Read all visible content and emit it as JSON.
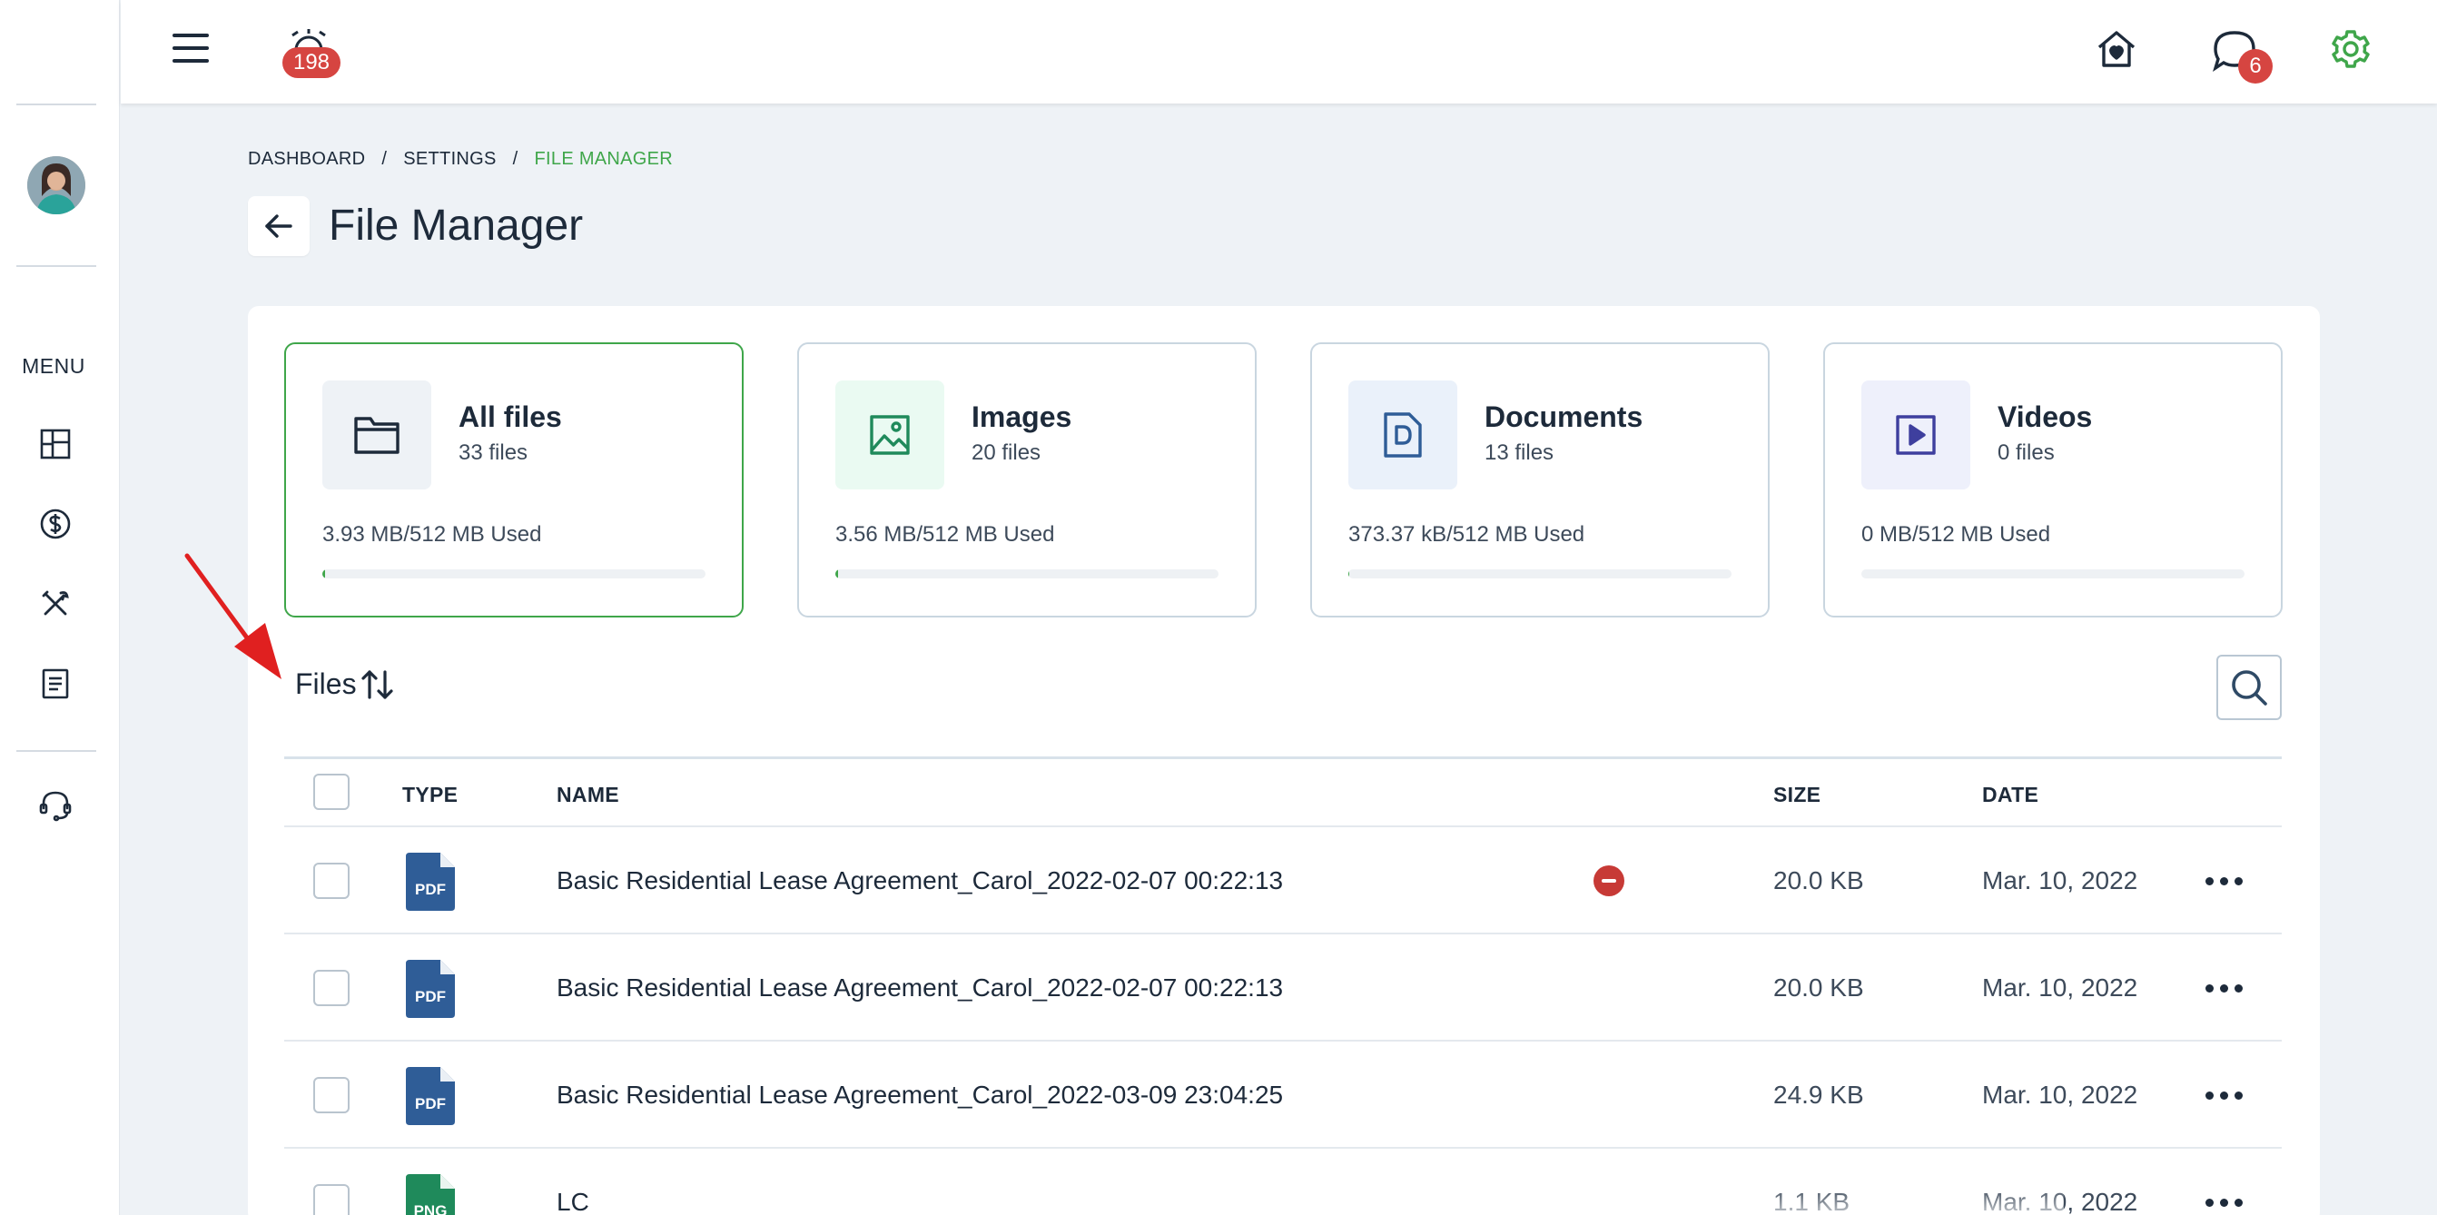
{
  "topbar": {
    "notification_count": "198",
    "messages_count": "6"
  },
  "sidebar": {
    "menu_label": "MENU",
    "items": [
      {
        "icon": "dashboard-icon"
      },
      {
        "icon": "dollar-icon"
      },
      {
        "icon": "tools-icon"
      },
      {
        "icon": "document-icon"
      },
      {
        "icon": "support-icon"
      }
    ]
  },
  "breadcrumb": {
    "items": [
      "DASHBOARD",
      "SETTINGS",
      "FILE MANAGER"
    ],
    "separator": "/"
  },
  "page": {
    "title": "File Manager"
  },
  "stats": [
    {
      "title": "All files",
      "count": "33 files",
      "used": "3.93 MB/512 MB Used",
      "fraction": 0.0077,
      "icon": "folder-icon",
      "active": true
    },
    {
      "title": "Images",
      "count": "20 files",
      "used": "3.56 MB/512 MB Used",
      "fraction": 0.007,
      "icon": "image-icon",
      "active": false
    },
    {
      "title": "Documents",
      "count": "13 files",
      "used": "373.37 kB/512 MB Used",
      "fraction": 0.0007,
      "icon": "doc-icon",
      "active": false
    },
    {
      "title": "Videos",
      "count": "0 files",
      "used": "0 MB/512 MB Used",
      "fraction": 0,
      "icon": "video-icon",
      "active": false
    }
  ],
  "files_section": {
    "heading": "Files",
    "sort_icon": "sort-icon",
    "search_icon": "search-icon"
  },
  "table": {
    "columns": [
      "TYPE",
      "NAME",
      "SIZE",
      "DATE"
    ],
    "rows": [
      {
        "type": "PDF",
        "name": "Basic Residential Lease Agreement_Carol_2022-02-07 00:22:13",
        "size": "20.0 KB",
        "date": "Mar. 10, 2022",
        "has_remove": true
      },
      {
        "type": "PDF",
        "name": "Basic Residential Lease Agreement_Carol_2022-02-07 00:22:13",
        "size": "20.0 KB",
        "date": "Mar. 10, 2022",
        "has_remove": false
      },
      {
        "type": "PDF",
        "name": "Basic Residential Lease Agreement_Carol_2022-03-09 23:04:25",
        "size": "24.9 KB",
        "date": "Mar. 10, 2022",
        "has_remove": false
      },
      {
        "type": "PNG",
        "name": "LC",
        "size": "1.1 KB",
        "date": "Mar. 10, 2022",
        "has_remove": false
      }
    ]
  },
  "colors": {
    "accent_green": "#3fa64a",
    "badge_red": "#d64541",
    "pdf_blue": "#2f5d97",
    "png_green": "#1f8a5b"
  }
}
